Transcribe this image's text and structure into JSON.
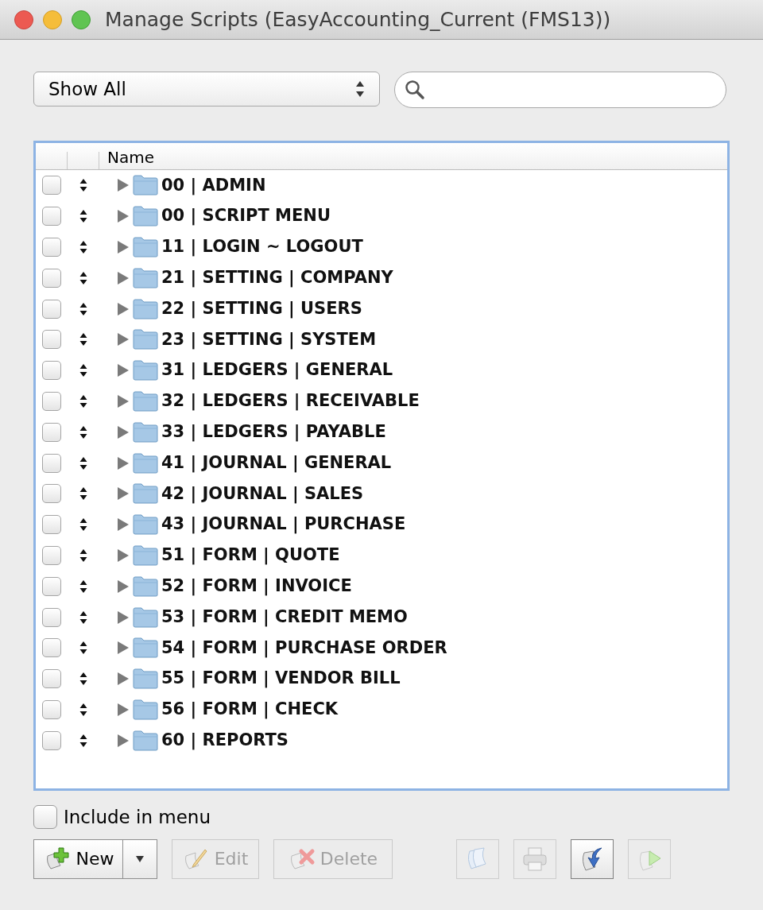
{
  "window": {
    "title": "Manage Scripts (EasyAccounting_Current (FMS13))"
  },
  "filter": {
    "value": "Show All"
  },
  "list": {
    "columns": [
      "Name"
    ],
    "rows": [
      {
        "name": "00 | ADMIN",
        "checked": false,
        "expanded": false
      },
      {
        "name": "00 | SCRIPT MENU",
        "checked": false,
        "expanded": false
      },
      {
        "name": "11 | LOGIN ~ LOGOUT",
        "checked": false,
        "expanded": false
      },
      {
        "name": "21 | SETTING | COMPANY",
        "checked": false,
        "expanded": false
      },
      {
        "name": "22 | SETTING | USERS",
        "checked": false,
        "expanded": false
      },
      {
        "name": "23 | SETTING | SYSTEM",
        "checked": false,
        "expanded": false
      },
      {
        "name": "31 | LEDGERS | GENERAL",
        "checked": false,
        "expanded": false
      },
      {
        "name": "32 | LEDGERS | RECEIVABLE",
        "checked": false,
        "expanded": false
      },
      {
        "name": "33 | LEDGERS | PAYABLE",
        "checked": false,
        "expanded": false
      },
      {
        "name": "41 | JOURNAL | GENERAL",
        "checked": false,
        "expanded": false
      },
      {
        "name": "42 | JOURNAL | SALES",
        "checked": false,
        "expanded": false
      },
      {
        "name": "43 | JOURNAL | PURCHASE",
        "checked": false,
        "expanded": false
      },
      {
        "name": "51 | FORM | QUOTE",
        "checked": false,
        "expanded": false
      },
      {
        "name": "52 | FORM | INVOICE",
        "checked": false,
        "expanded": false
      },
      {
        "name": "53 | FORM | CREDIT MEMO",
        "checked": false,
        "expanded": false
      },
      {
        "name": "54 | FORM | PURCHASE ORDER",
        "checked": false,
        "expanded": false
      },
      {
        "name": "55 | FORM | VENDOR BILL",
        "checked": false,
        "expanded": false
      },
      {
        "name": "56 | FORM | CHECK",
        "checked": false,
        "expanded": false
      },
      {
        "name": "60 | REPORTS",
        "checked": false,
        "expanded": false
      }
    ]
  },
  "include_in_menu": {
    "label": "Include in menu",
    "checked": false
  },
  "buttons": [
    {
      "kind": "new",
      "label": "New",
      "disabled": false
    },
    {
      "kind": "edit",
      "label": "Edit",
      "disabled": true
    },
    {
      "kind": "delete",
      "label": "Delete",
      "disabled": true
    }
  ],
  "tool_buttons": [
    {
      "kind": "duplicate",
      "disabled": true
    },
    {
      "kind": "print",
      "disabled": true
    },
    {
      "kind": "import",
      "disabled": false
    },
    {
      "kind": "run",
      "disabled": true
    }
  ]
}
